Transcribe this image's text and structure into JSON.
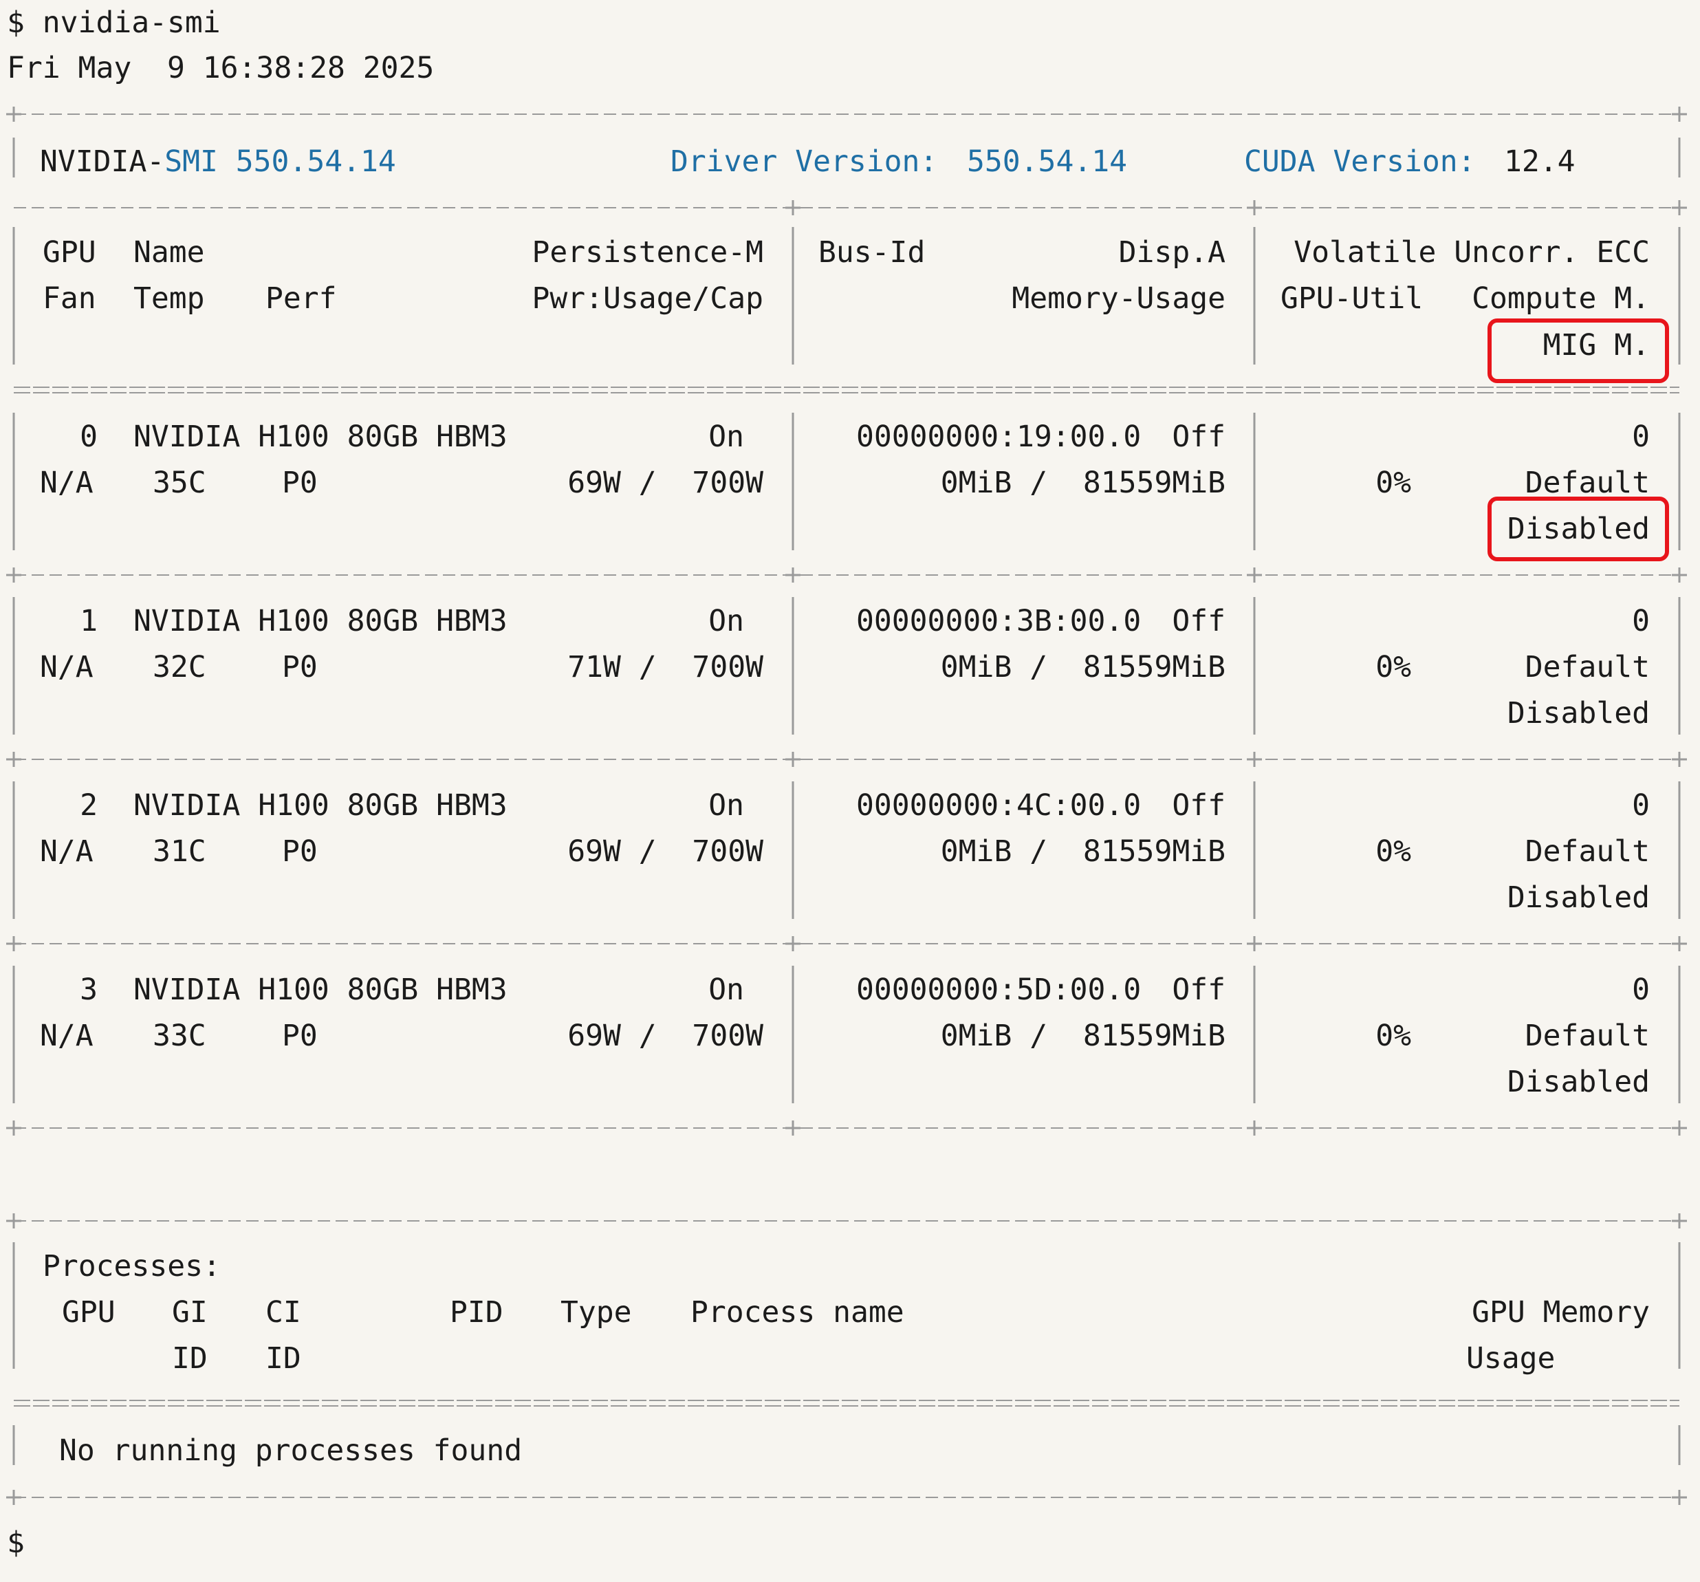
{
  "terminal": {
    "prompt": "$",
    "command": "nvidia-smi",
    "timestamp": "Fri May  9 16:38:28 2025",
    "final_prompt": "$"
  },
  "header": {
    "smi_prefix": "NVIDIA-",
    "smi_name": "SMI 550.54.14",
    "driver_label": "Driver Version:",
    "driver_version": "550.54.14",
    "cuda_label": "CUDA Version:",
    "cuda_version": "12.4"
  },
  "columns": {
    "gpu": "GPU",
    "name": "Name",
    "persistence": "Persistence-M",
    "bus_id": "Bus-Id",
    "disp": "Disp.A",
    "volatile_ecc": "Volatile Uncorr. ECC",
    "fan": "Fan",
    "temp": "Temp",
    "perf": "Perf",
    "pwr": "Pwr:Usage/Cap",
    "memory_usage": "Memory-Usage",
    "gpu_util": "GPU-Util",
    "compute_mode": "Compute M.",
    "mig_mode": "MIG M."
  },
  "gpus": [
    {
      "index": "0",
      "name": "NVIDIA H100 80GB HBM3",
      "persistence": "On",
      "bus_id": "00000000:19:00.0",
      "disp": "Off",
      "ecc": "0",
      "fan": "N/A",
      "temp": "35C",
      "perf": "P0",
      "pwr": "69W /  700W",
      "memory": "0MiB /  81559MiB",
      "util": "0%",
      "compute": "Default",
      "mig": "Disabled"
    },
    {
      "index": "1",
      "name": "NVIDIA H100 80GB HBM3",
      "persistence": "On",
      "bus_id": "00000000:3B:00.0",
      "disp": "Off",
      "ecc": "0",
      "fan": "N/A",
      "temp": "32C",
      "perf": "P0",
      "pwr": "71W /  700W",
      "memory": "0MiB /  81559MiB",
      "util": "0%",
      "compute": "Default",
      "mig": "Disabled"
    },
    {
      "index": "2",
      "name": "NVIDIA H100 80GB HBM3",
      "persistence": "On",
      "bus_id": "00000000:4C:00.0",
      "disp": "Off",
      "ecc": "0",
      "fan": "N/A",
      "temp": "31C",
      "perf": "P0",
      "pwr": "69W /  700W",
      "memory": "0MiB /  81559MiB",
      "util": "0%",
      "compute": "Default",
      "mig": "Disabled"
    },
    {
      "index": "3",
      "name": "NVIDIA H100 80GB HBM3",
      "persistence": "On",
      "bus_id": "00000000:5D:00.0",
      "disp": "Off",
      "ecc": "0",
      "fan": "N/A",
      "temp": "33C",
      "perf": "P0",
      "pwr": "69W /  700W",
      "memory": "0MiB /  81559MiB",
      "util": "0%",
      "compute": "Default",
      "mig": "Disabled"
    }
  ],
  "processes": {
    "title": "Processes:",
    "col_gpu": "GPU",
    "col_gi": "GI",
    "col_ci": "CI",
    "col_pid": "PID",
    "col_type": "Type",
    "col_name": "Process name",
    "col_mem": "GPU Memory",
    "gi_sub": "ID",
    "ci_sub": "ID",
    "mem_sub": "Usage",
    "empty_message": "No running processes found"
  },
  "highlight_color": "#e8151b",
  "accent_color": "#1f6fa5"
}
